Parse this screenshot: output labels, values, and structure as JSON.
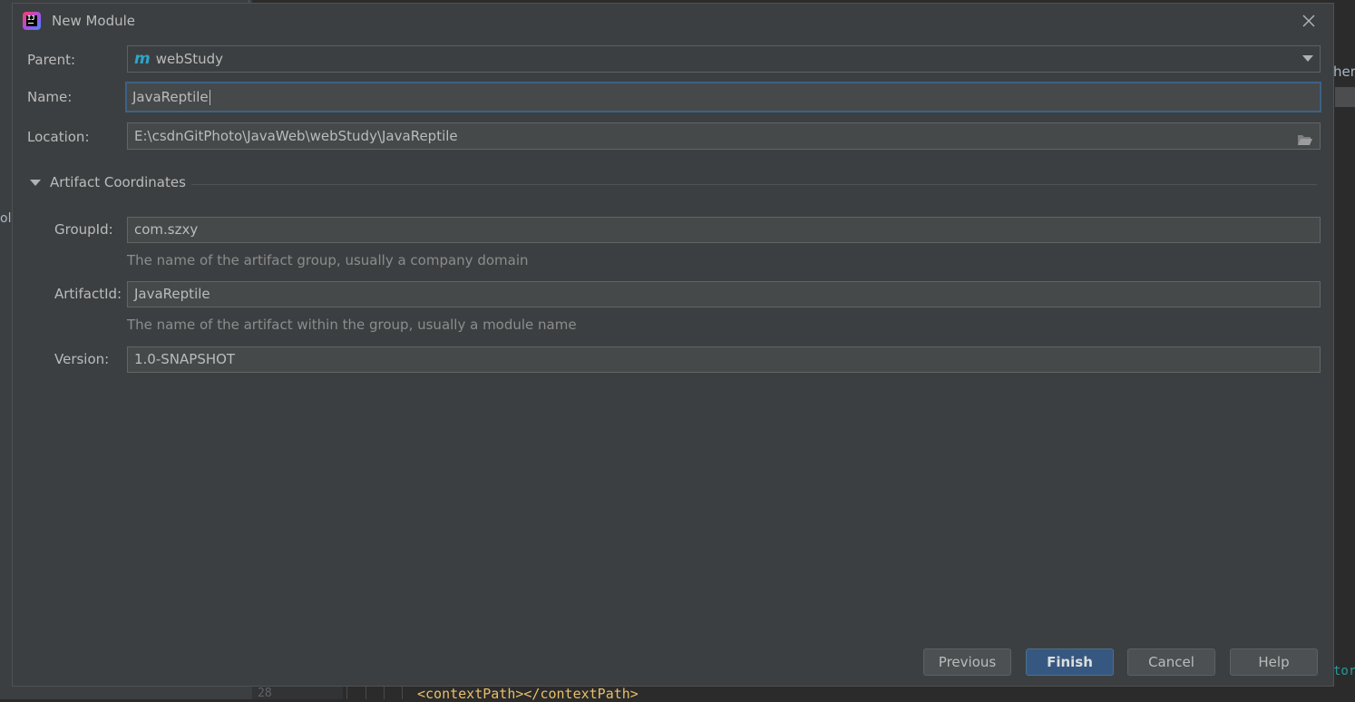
{
  "dialog": {
    "title": "New Module"
  },
  "form": {
    "parent_label": "Parent:",
    "parent_value": "webStudy",
    "parent_icon": "m",
    "name_label": "Name:",
    "name_value": "JavaReptile",
    "location_label": "Location:",
    "location_value": "E:\\csdnGitPhoto\\JavaWeb\\webStudy\\JavaReptile"
  },
  "artifact": {
    "section_title": "Artifact Coordinates",
    "group_label": "GroupId:",
    "group_value": "com.szxy",
    "group_hint": "The name of the artifact group, usually a company domain",
    "artifact_label": "ArtifactId:",
    "artifact_value": "JavaReptile",
    "artifact_hint": "The name of the artifact within the group, usually a module name",
    "version_label": "Version:",
    "version_value": "1.0-SNAPSHOT"
  },
  "buttons": {
    "previous": "Previous",
    "finish": "Finish",
    "cancel": "Cancel",
    "help": "Help"
  },
  "background": {
    "line_number": "28",
    "code": "<contextPath></contextPath>",
    "right_text_top": "her",
    "right_text_bottom": "tor",
    "left_text": "ol"
  },
  "colors": {
    "dialog_bg": "#3c3f41",
    "field_bg": "#45494a",
    "focus_border": "#3d6185",
    "primary_button": "#365880",
    "maven_icon": "#2fa4c8"
  }
}
